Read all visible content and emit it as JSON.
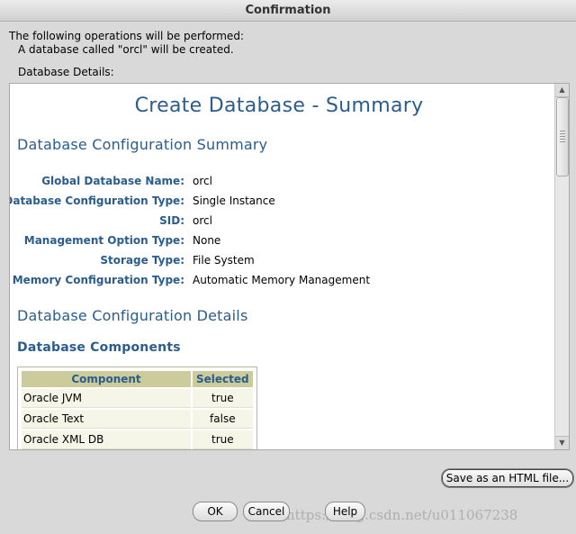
{
  "window": {
    "title": "Confirmation"
  },
  "intro": {
    "line1": "The following operations will be performed:",
    "line2": "A database called \"orcl\" will be created."
  },
  "details_label": "Database Details:",
  "summary": {
    "title": "Create Database - Summary",
    "config_summary_heading": "Database Configuration Summary",
    "fields": [
      {
        "label": "Global Database Name:",
        "value": "orcl"
      },
      {
        "label": "Database Configuration Type:",
        "value": "Single Instance"
      },
      {
        "label": "SID:",
        "value": "orcl"
      },
      {
        "label": "Management Option Type:",
        "value": "None"
      },
      {
        "label": "Storage Type:",
        "value": "File System"
      },
      {
        "label": "Memory Configuration Type:",
        "value": "Automatic Memory Management"
      }
    ],
    "config_details_heading": "Database Configuration Details",
    "components_heading": "Database Components",
    "components_table": {
      "headers": {
        "component": "Component",
        "selected": "Selected"
      },
      "rows": [
        {
          "component": "Oracle JVM",
          "selected": "true"
        },
        {
          "component": "Oracle Text",
          "selected": "false"
        },
        {
          "component": "Oracle XML DB",
          "selected": "true"
        }
      ]
    }
  },
  "buttons": {
    "save_html": "Save as an HTML file...",
    "ok": "OK",
    "cancel": "Cancel",
    "help": "Help"
  },
  "watermark": "https://blog.csdn.net/u011067238"
}
